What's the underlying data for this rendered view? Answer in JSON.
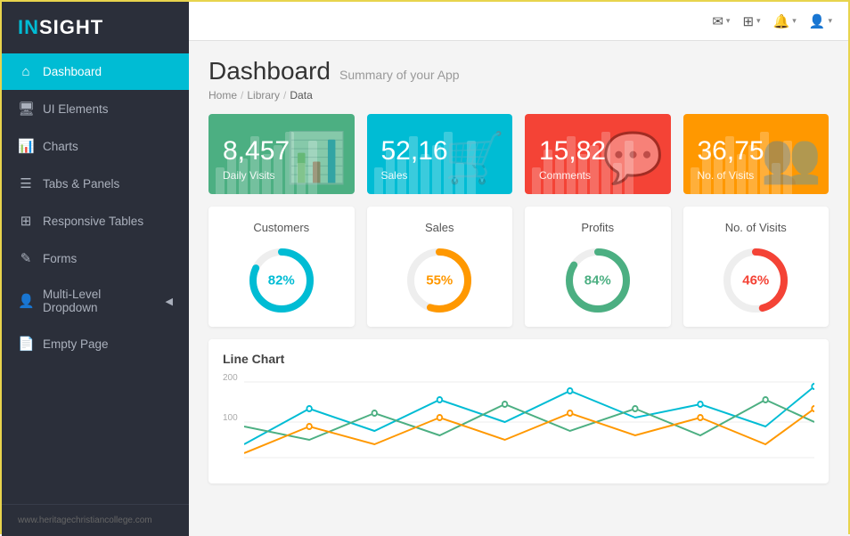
{
  "logo": {
    "in": "IN",
    "sight": "SIGHT"
  },
  "sidebar": {
    "items": [
      {
        "id": "dashboard",
        "label": "Dashboard",
        "icon": "⌂",
        "active": true,
        "arrow": false
      },
      {
        "id": "ui-elements",
        "label": "UI Elements",
        "icon": "🖥",
        "active": false,
        "arrow": false
      },
      {
        "id": "charts",
        "label": "Charts",
        "icon": "📊",
        "active": false,
        "arrow": false
      },
      {
        "id": "tabs",
        "label": "Tabs & Panels",
        "icon": "☰",
        "active": false,
        "arrow": false
      },
      {
        "id": "responsive",
        "label": "Responsive Tables",
        "icon": "⊞",
        "active": false,
        "arrow": false
      },
      {
        "id": "forms",
        "label": "Forms",
        "icon": "✎",
        "active": false,
        "arrow": false
      },
      {
        "id": "dropdown",
        "label": "Multi-Level Dropdown",
        "icon": "👤",
        "active": false,
        "arrow": true
      },
      {
        "id": "empty",
        "label": "Empty Page",
        "icon": "📄",
        "active": false,
        "arrow": false
      }
    ],
    "footer": "www.heritagechristiancollege.com"
  },
  "topbar": {
    "icons": [
      {
        "id": "mail",
        "glyph": "✉"
      },
      {
        "id": "grid",
        "glyph": "⊞"
      },
      {
        "id": "bell",
        "glyph": "🔔"
      },
      {
        "id": "user",
        "glyph": "👤"
      }
    ]
  },
  "page": {
    "title": "Dashboard",
    "subtitle": "Summary of your App",
    "breadcrumb": [
      "Home",
      "Library",
      "Data"
    ]
  },
  "stat_cards": [
    {
      "id": "daily-visits",
      "number": "8,457",
      "label": "Daily Visits",
      "color": "card-green",
      "icon": "📊"
    },
    {
      "id": "sales",
      "number": "52,16",
      "label": "Sales",
      "color": "card-cyan",
      "icon": "🛒"
    },
    {
      "id": "comments",
      "number": "15,82",
      "label": "Comments",
      "color": "card-red",
      "icon": "💬"
    },
    {
      "id": "no-visits",
      "number": "36,75",
      "label": "No. of Visits",
      "color": "card-orange",
      "icon": "👥"
    }
  ],
  "donut_cards": [
    {
      "id": "customers",
      "title": "Customers",
      "pct": 82,
      "color": "#00bcd4",
      "label": "82%"
    },
    {
      "id": "sales",
      "title": "Sales",
      "pct": 55,
      "color": "#ff9800",
      "label": "55%"
    },
    {
      "id": "profits",
      "title": "Profits",
      "pct": 84,
      "color": "#4caf82",
      "label": "84%"
    },
    {
      "id": "no-of-visits",
      "title": "No. of Visits",
      "pct": 46,
      "color": "#f44336",
      "label": "46%"
    }
  ],
  "line_chart": {
    "title": "Line Chart",
    "y_labels": [
      "200",
      "100"
    ],
    "colors": [
      "#00bcd4",
      "#4caf82",
      "#ff9800"
    ]
  }
}
